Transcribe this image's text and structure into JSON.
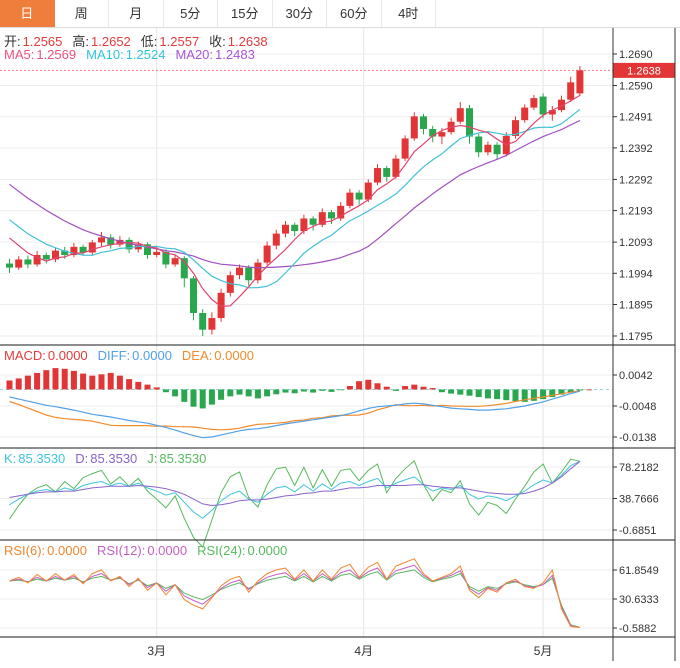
{
  "tabs": [
    {
      "label": "日",
      "active": true
    },
    {
      "label": "周",
      "active": false
    },
    {
      "label": "月",
      "active": false
    },
    {
      "label": "5分",
      "active": false
    },
    {
      "label": "15分",
      "active": false
    },
    {
      "label": "30分",
      "active": false
    },
    {
      "label": "60分",
      "active": false
    },
    {
      "label": "4时",
      "active": false
    }
  ],
  "main": {
    "ohlc": [
      {
        "label": "开:",
        "value": "1.2565"
      },
      {
        "label": "高:",
        "value": "1.2652"
      },
      {
        "label": "低:",
        "value": "1.2557"
      },
      {
        "label": "收:",
        "value": "1.2638"
      }
    ],
    "ma_header": [
      {
        "label": "MA5:",
        "value": "1.2569",
        "color": "#e8537f"
      },
      {
        "label": "MA10:",
        "value": "1.2524",
        "color": "#2fc4d9"
      },
      {
        "label": "MA20:",
        "value": "1.2483",
        "color": "#a855d8"
      }
    ],
    "last_price": "1.2638"
  },
  "macd_header": [
    {
      "label": "MACD:",
      "value": "0.0000",
      "color": "#e23b3b"
    },
    {
      "label": "DIFF:",
      "value": "0.0000",
      "color": "#52a0e8"
    },
    {
      "label": "DEA:",
      "value": "0.0000",
      "color": "#f08c2e"
    }
  ],
  "kdj_header": [
    {
      "label": "K:",
      "value": "85.3530",
      "color": "#3ec6dc"
    },
    {
      "label": "D:",
      "value": "85.3530",
      "color": "#8a63cc"
    },
    {
      "label": "J:",
      "value": "85.3530",
      "color": "#58b95f"
    }
  ],
  "rsi_header": [
    {
      "label": "RSI(6):",
      "value": "0.0000",
      "color": "#f0862d"
    },
    {
      "label": "RSI(12):",
      "value": "0.0000",
      "color": "#c45fc4"
    },
    {
      "label": "RSI(24):",
      "value": "0.0000",
      "color": "#58b95f"
    }
  ],
  "chart_data": {
    "type": "candlestick",
    "months": [
      {
        "label": "3月",
        "i": 16
      },
      {
        "label": "4月",
        "i": 38.5
      },
      {
        "label": "5月",
        "i": 58
      }
    ],
    "main_ticks": [
      1.269,
      1.259,
      1.2491,
      1.2392,
      1.2292,
      1.2193,
      1.2093,
      1.1994,
      1.1895,
      1.1795
    ],
    "last_price": 1.2638,
    "prior_closes": [
      1.25,
      1.248,
      1.2462,
      1.244,
      1.2425,
      1.2405,
      1.2385,
      1.236,
      1.2335,
      1.231,
      1.2288,
      1.2265,
      1.2242,
      1.222,
      1.22,
      1.218,
      1.216,
      1.214,
      1.212,
      1.21
    ],
    "candles": [
      [
        1.2025,
        1.204,
        1.1995,
        1.2012
      ],
      [
        1.2012,
        1.2048,
        1.2005,
        1.2038
      ],
      [
        1.2038,
        1.205,
        1.201,
        1.2022
      ],
      [
        1.2022,
        1.2065,
        1.2015,
        1.2052
      ],
      [
        1.2052,
        1.206,
        1.2025,
        1.2038
      ],
      [
        1.2038,
        1.2075,
        1.203,
        1.2066
      ],
      [
        1.2066,
        1.2078,
        1.204,
        1.2052
      ],
      [
        1.2052,
        1.209,
        1.2045,
        1.2078
      ],
      [
        1.2078,
        1.2085,
        1.205,
        1.206
      ],
      [
        1.206,
        1.21,
        1.2052,
        1.2092
      ],
      [
        1.2092,
        1.2125,
        1.208,
        1.2108
      ],
      [
        1.2108,
        1.2118,
        1.2072,
        1.2085
      ],
      [
        1.2085,
        1.2112,
        1.2078,
        1.21
      ],
      [
        1.21,
        1.2108,
        1.2058,
        1.207
      ],
      [
        1.207,
        1.2095,
        1.206,
        1.2086
      ],
      [
        1.2086,
        1.2092,
        1.204,
        1.2052
      ],
      [
        1.2052,
        1.2078,
        1.2045,
        1.2062
      ],
      [
        1.2062,
        1.207,
        1.201,
        1.2022
      ],
      [
        1.2022,
        1.2052,
        1.2015,
        1.2042
      ],
      [
        1.2042,
        1.2048,
        1.195,
        1.1978
      ],
      [
        1.1978,
        1.1985,
        1.1845,
        1.1868
      ],
      [
        1.1868,
        1.188,
        1.1795,
        1.1815
      ],
      [
        1.1815,
        1.187,
        1.18,
        1.1852
      ],
      [
        1.1852,
        1.1945,
        1.184,
        1.1932
      ],
      [
        1.1932,
        1.2,
        1.192,
        1.1988
      ],
      [
        1.1988,
        1.2022,
        1.1975,
        1.2012
      ],
      [
        1.2012,
        1.202,
        1.1955,
        1.1972
      ],
      [
        1.1972,
        1.204,
        1.1962,
        1.2028
      ],
      [
        1.2028,
        1.2095,
        1.202,
        1.2082
      ],
      [
        1.2082,
        1.2132,
        1.207,
        1.212
      ],
      [
        1.212,
        1.216,
        1.2108,
        1.2148
      ],
      [
        1.2148,
        1.2155,
        1.2112,
        1.2128
      ],
      [
        1.2128,
        1.218,
        1.2118,
        1.2168
      ],
      [
        1.2168,
        1.2175,
        1.213,
        1.2148
      ],
      [
        1.2148,
        1.22,
        1.214,
        1.2188
      ],
      [
        1.2188,
        1.2195,
        1.215,
        1.2168
      ],
      [
        1.2168,
        1.222,
        1.216,
        1.2208
      ],
      [
        1.2208,
        1.2262,
        1.22,
        1.225
      ],
      [
        1.225,
        1.2258,
        1.2212,
        1.2228
      ],
      [
        1.2228,
        1.2292,
        1.222,
        1.2282
      ],
      [
        1.2282,
        1.234,
        1.2274,
        1.2328
      ],
      [
        1.2328,
        1.2335,
        1.2285,
        1.23
      ],
      [
        1.23,
        1.237,
        1.2294,
        1.2358
      ],
      [
        1.2358,
        1.2432,
        1.235,
        1.2422
      ],
      [
        1.2422,
        1.2505,
        1.2415,
        1.2492
      ],
      [
        1.2492,
        1.25,
        1.2435,
        1.2452
      ],
      [
        1.2452,
        1.2462,
        1.241,
        1.2428
      ],
      [
        1.2428,
        1.2455,
        1.2404,
        1.2442
      ],
      [
        1.2442,
        1.2488,
        1.2434,
        1.2475
      ],
      [
        1.2475,
        1.2538,
        1.2468,
        1.2518
      ],
      [
        1.2518,
        1.2528,
        1.2405,
        1.2428
      ],
      [
        1.2428,
        1.2436,
        1.2362,
        1.2378
      ],
      [
        1.2378,
        1.2412,
        1.2368,
        1.2402
      ],
      [
        1.2402,
        1.241,
        1.2355,
        1.2372
      ],
      [
        1.2372,
        1.2442,
        1.2365,
        1.243
      ],
      [
        1.243,
        1.2492,
        1.2422,
        1.248
      ],
      [
        1.248,
        1.253,
        1.2472,
        1.252
      ],
      [
        1.252,
        1.256,
        1.2512,
        1.255
      ],
      [
        1.2555,
        1.2565,
        1.2486,
        1.2498
      ],
      [
        1.2498,
        1.2525,
        1.2478,
        1.2512
      ],
      [
        1.2512,
        1.2558,
        1.2505,
        1.2545
      ],
      [
        1.2545,
        1.2618,
        1.2538,
        1.26
      ],
      [
        1.2565,
        1.2652,
        1.2557,
        1.2638
      ]
    ],
    "macd": {
      "ticks": [
        0.0042,
        -0.0048,
        -0.0138
      ],
      "hist": [
        0.0026,
        0.0032,
        0.004,
        0.0048,
        0.0056,
        0.0062,
        0.006,
        0.0054,
        0.0046,
        0.004,
        0.0044,
        0.0048,
        0.004,
        0.003,
        0.0022,
        0.0014,
        0.0006,
        -0.0008,
        -0.002,
        -0.0036,
        -0.005,
        -0.0055,
        -0.0044,
        -0.003,
        -0.002,
        -0.0015,
        -0.002,
        -0.0026,
        -0.002,
        -0.0014,
        -0.0009,
        -0.0011,
        -0.0006,
        -0.0009,
        -0.0004,
        -0.0007,
        -0.0002,
        0.001,
        0.0024,
        0.0028,
        0.0018,
        0.0008,
        -0.0004,
        0.001,
        0.0014,
        0.0008,
        0.0004,
        -0.0008,
        -0.0012,
        -0.0015,
        -0.0018,
        -0.0022,
        -0.0026,
        -0.0028,
        -0.0031,
        -0.0034,
        -0.0036,
        -0.0033,
        -0.0028,
        -0.0022,
        -0.0015,
        -0.0008,
        -0.0003,
        0.0
      ],
      "diff": [
        -0.0022,
        -0.0028,
        -0.0034,
        -0.004,
        -0.0046,
        -0.005,
        -0.0055,
        -0.006,
        -0.0066,
        -0.0072,
        -0.0076,
        -0.008,
        -0.0085,
        -0.009,
        -0.0094,
        -0.0098,
        -0.0104,
        -0.011,
        -0.0118,
        -0.0126,
        -0.0134,
        -0.014,
        -0.0138,
        -0.0132,
        -0.0126,
        -0.012,
        -0.0116,
        -0.0114,
        -0.011,
        -0.0105,
        -0.01,
        -0.0096,
        -0.0092,
        -0.0088,
        -0.0084,
        -0.008,
        -0.0076,
        -0.007,
        -0.0062,
        -0.0055,
        -0.005,
        -0.0048,
        -0.0046,
        -0.0042,
        -0.004,
        -0.0042,
        -0.0046,
        -0.005,
        -0.0054,
        -0.0056,
        -0.0058,
        -0.006,
        -0.006,
        -0.0058,
        -0.0056,
        -0.0052,
        -0.0048,
        -0.0042,
        -0.0036,
        -0.0028,
        -0.002,
        -0.0012,
        -0.0005
      ]
    },
    "kdj": {
      "ticks": [
        78.2182,
        38.7666,
        -0.6851
      ],
      "k": [
        31,
        38,
        44,
        48,
        50,
        47,
        52,
        49,
        55,
        58,
        60,
        55,
        58,
        54,
        58,
        52,
        48,
        43,
        46,
        34,
        22,
        14,
        24,
        36,
        44,
        48,
        38,
        34,
        44,
        52,
        54,
        47,
        56,
        48,
        57,
        50,
        58,
        60,
        55,
        60,
        64,
        52,
        58,
        62,
        66,
        56,
        48,
        52,
        50,
        55,
        44,
        38,
        42,
        40,
        36,
        42,
        48,
        56,
        62,
        58,
        68,
        80,
        85.35
      ],
      "d": [
        40,
        42,
        44,
        46,
        47,
        47,
        48,
        48,
        50,
        52,
        53,
        54,
        54,
        54,
        55,
        54,
        53,
        51,
        48,
        44,
        38,
        32,
        30,
        31,
        33,
        36,
        37,
        37,
        38,
        40,
        42,
        43,
        45,
        46,
        48,
        48,
        50,
        52,
        52,
        53,
        55,
        55,
        55,
        55,
        56,
        56,
        54,
        53,
        52,
        52,
        50,
        48,
        46,
        45,
        44,
        44,
        45,
        48,
        52,
        58,
        66,
        76,
        85.35
      ]
    },
    "rsi": {
      "ticks": [
        61.8549,
        30.6333,
        -0.5882
      ],
      "r6": [
        50,
        54,
        48,
        57,
        50,
        58,
        51,
        57,
        47,
        58,
        62,
        50,
        55,
        44,
        53,
        40,
        48,
        35,
        46,
        30,
        24,
        20,
        32,
        45,
        52,
        55,
        38,
        50,
        58,
        62,
        64,
        52,
        62,
        50,
        62,
        52,
        64,
        68,
        54,
        65,
        70,
        52,
        66,
        70,
        74,
        58,
        50,
        54,
        58,
        66,
        40,
        32,
        42,
        38,
        48,
        52,
        44,
        42,
        48,
        62,
        20,
        1,
        0
      ],
      "r12": [
        50,
        52,
        49,
        54,
        50,
        55,
        51,
        55,
        48,
        55,
        58,
        51,
        54,
        46,
        52,
        43,
        48,
        39,
        46,
        34,
        29,
        25,
        33,
        42,
        48,
        51,
        41,
        48,
        54,
        57,
        59,
        51,
        58,
        50,
        58,
        51,
        59,
        62,
        53,
        60,
        64,
        52,
        61,
        64,
        67,
        56,
        50,
        53,
        56,
        61,
        42,
        36,
        43,
        40,
        48,
        50,
        45,
        43,
        46,
        56,
        22,
        2,
        0
      ],
      "r24": [
        50,
        51,
        49,
        52,
        50,
        53,
        51,
        53,
        49,
        53,
        55,
        51,
        53,
        47,
        51,
        45,
        48,
        42,
        46,
        37,
        33,
        30,
        35,
        41,
        45,
        48,
        42,
        47,
        51,
        53,
        55,
        50,
        55,
        49,
        55,
        50,
        56,
        58,
        52,
        57,
        60,
        51,
        58,
        60,
        62,
        54,
        49,
        52,
        54,
        58,
        44,
        39,
        44,
        42,
        47,
        49,
        46,
        44,
        46,
        53,
        24,
        3,
        0
      ]
    },
    "colors": {
      "up": "#e23535",
      "down": "#2aa74e",
      "ma5": "#e0446e",
      "ma10": "#40c0d8",
      "ma20": "#a050c0",
      "diff": "#52a0e8",
      "dea": "#f08c2e",
      "k": "#3ec6dc",
      "d": "#8a63cc",
      "j": "#58b95f",
      "rsi6": "#f0862d",
      "rsi12": "#c45fc4",
      "rsi24": "#58b95f",
      "grid": "#ededed",
      "axis": "#333333",
      "separator": "#1a1a1a",
      "price_line": "#f28080",
      "zero_line": "#8fd8e0",
      "badge_text": "#ffffff",
      "accent_tab": "#ef7d3b"
    }
  }
}
